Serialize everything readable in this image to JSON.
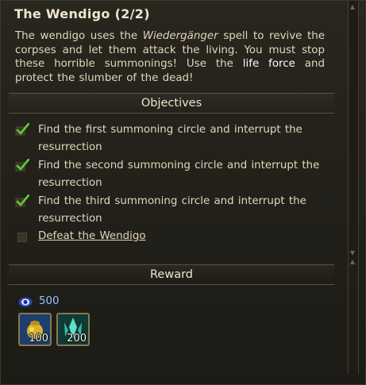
{
  "quest": {
    "title": "The Wendigo (2/2)",
    "description": {
      "part1": "The wendigo uses the ",
      "spell": "Wiedergänger",
      "part2": " spell to revive the corpses and let them attack the living. You must stop these horrible summonings! Use the ",
      "kw1": "life",
      "kw2": "force",
      "part3": " and protect the slumber of the dead!"
    }
  },
  "objectives": {
    "heading": "Objectives",
    "items": [
      {
        "label": "Find the first summoning circle and interrupt the resurrection",
        "done": true
      },
      {
        "label": "Find the second summoning circle and interrupt the resurrection",
        "done": true
      },
      {
        "label": "Find the third summoning circle and interrupt the resurrection",
        "done": true
      },
      {
        "label": "Defeat the Wendigo",
        "done": false
      }
    ]
  },
  "reward": {
    "heading": "Reward",
    "experience": "500",
    "items": [
      {
        "icon": "gold-pouch-icon",
        "qty": "100"
      },
      {
        "icon": "crystal-icon",
        "qty": "200"
      }
    ]
  },
  "colors": {
    "check": "#5ccf3a",
    "xp": "#9cc0ff",
    "frame": "#8a7850"
  }
}
